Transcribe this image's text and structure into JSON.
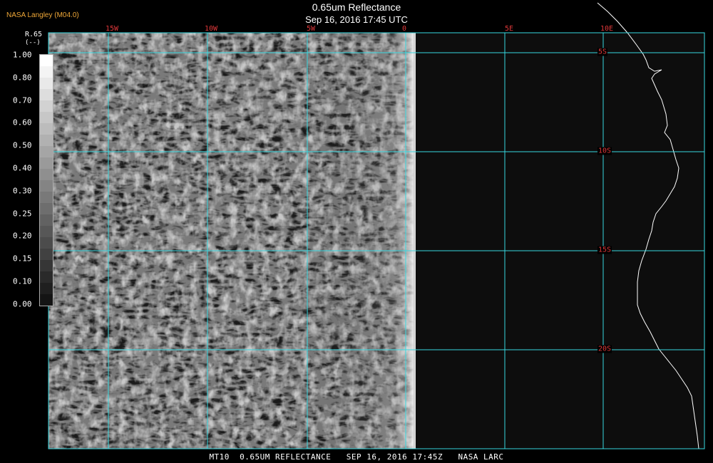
{
  "credit": "NASA Langley (M04.0)",
  "title": "0.65um Reflectance",
  "subtitle": "Sep 16, 2016 17:45 UTC",
  "footer": "MT10  0.65UM REFLECTANCE   SEP 16, 2016 17:45Z   NASA LARC",
  "colorbar": {
    "variable": "R.65",
    "unit": "(--)",
    "ticks": [
      "1.00",
      "0.80",
      "0.70",
      "0.60",
      "0.50",
      "0.40",
      "0.30",
      "0.25",
      "0.20",
      "0.15",
      "0.10",
      "0.00"
    ]
  },
  "map": {
    "longitude_labels": [
      "15W",
      "10W",
      "5W",
      "0",
      "5E",
      "10E"
    ],
    "latitude_labels": [
      "5S",
      "10S",
      "15S",
      "20S"
    ],
    "grid_color": "#38d8e0",
    "label_color": "#e0383a",
    "coast_color": "#ffffff"
  }
}
